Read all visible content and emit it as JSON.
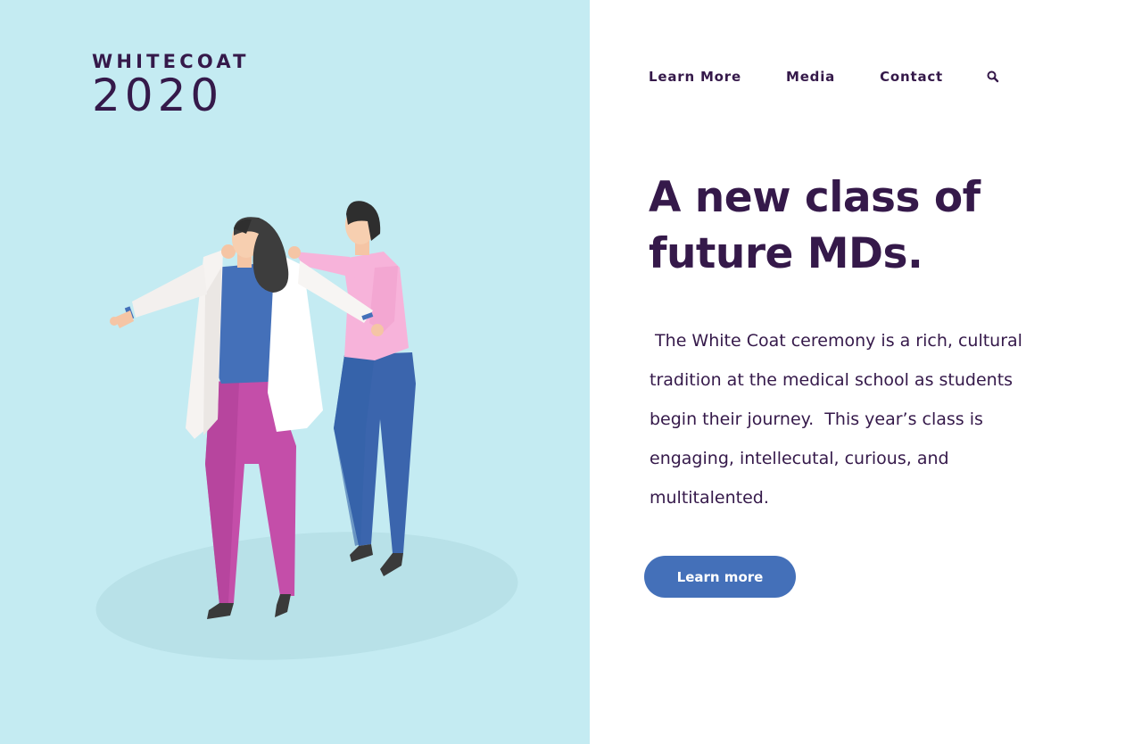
{
  "logo": {
    "line1": "WHITECOAT",
    "line2": "2020"
  },
  "nav": {
    "items": [
      {
        "label": "Learn More"
      },
      {
        "label": "Media"
      },
      {
        "label": "Contact"
      }
    ],
    "search_icon": "search-icon"
  },
  "hero": {
    "headline_line1": "A new class of",
    "headline_line2": "future MDs.",
    "description": " The White Coat ceremony is a rich, cultural tradition at the medical school as students begin their journey.  This year’s class is engaging, intellecutal, curious, and multitalented.",
    "cta_label": "Learn more"
  },
  "colors": {
    "left_panel_bg": "#c4ebf2",
    "text_primary": "#35194a",
    "button_bg": "#4470b9",
    "button_text": "#ffffff"
  }
}
